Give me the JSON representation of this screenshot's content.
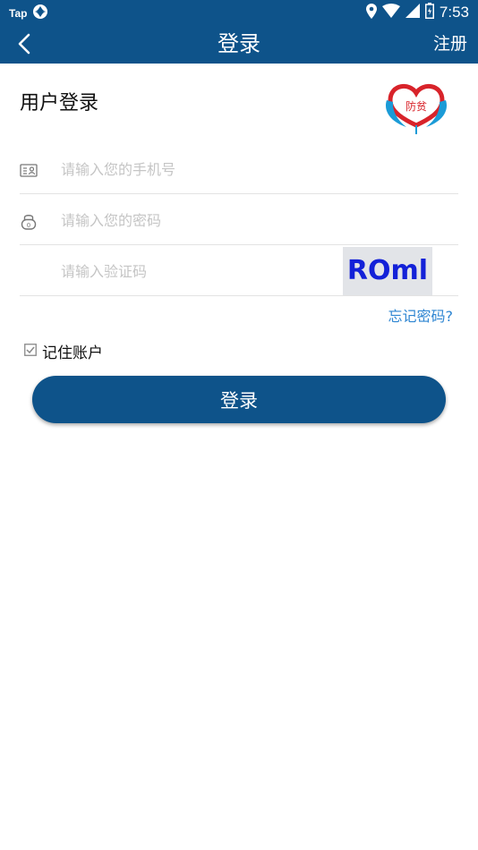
{
  "status_bar": {
    "app_label": "Tap",
    "time": "7:53"
  },
  "app_bar": {
    "title": "登录",
    "register_label": "注册"
  },
  "login_form": {
    "heading": "用户登录",
    "phone_placeholder": "请输入您的手机号",
    "password_placeholder": "请输入您的密码",
    "captcha_placeholder": "请输入验证码",
    "captcha_text": "ROml",
    "forgot_password_label": "忘记密码?",
    "remember_account_label": "记住账户",
    "remember_checked": true,
    "submit_label": "登录"
  },
  "logo": {
    "text": "防贫"
  },
  "colors": {
    "primary": "#0e538a",
    "link": "#2f86d2",
    "captcha_text": "#1321d8",
    "logo_red": "#d8232a",
    "logo_blue": "#1b9bd7"
  }
}
